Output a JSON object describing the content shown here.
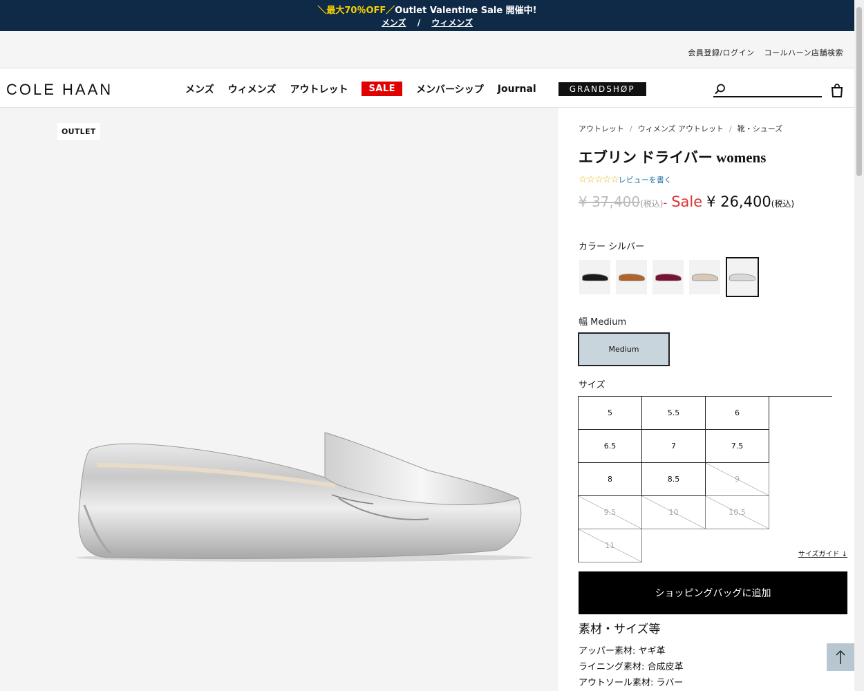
{
  "banner": {
    "promo_highlight": "＼最大70％OFF／",
    "promo_text": "Outlet Valentine Sale 開催中!",
    "link_mens": "メンズ",
    "separator": "/",
    "link_womens": "ウィメンズ"
  },
  "utility": {
    "login": "会員登録/ログイン",
    "store_locator": "コールハーン店舗検索"
  },
  "header": {
    "logo": "COLE HAAN",
    "nav": {
      "mens": "メンズ",
      "womens": "ウィメンズ",
      "outlet": "アウトレット",
      "sale": "SALE",
      "membership": "メンバーシップ",
      "journal": "Journal",
      "grandshop": "GRANDSHØP"
    },
    "search_placeholder": "",
    "search_icon": "search-icon",
    "bag_icon": "shopping-bag-icon"
  },
  "gallery": {
    "badge": "OUTLET"
  },
  "product": {
    "breadcrumb": [
      "アウトレット",
      "ウィメンズ アウトレット",
      "靴・シューズ"
    ],
    "breadcrumb_sep": "/",
    "title": "エブリン ドライバー womens",
    "stars": "☆☆☆☆☆",
    "review_link": "レビューを書く",
    "price": {
      "original": "¥ 37,400",
      "tax_note": "(税込)",
      "dash": "-",
      "sale_label": "Sale",
      "current": "¥ 26,400",
      "tax_note2": "(税込)"
    },
    "color_label": "カラー シルバー",
    "colors": [
      {
        "name": "black",
        "hex": "#1a1a1a"
      },
      {
        "name": "tan",
        "hex": "#b0642a"
      },
      {
        "name": "burgundy",
        "hex": "#7a1236"
      },
      {
        "name": "beige",
        "hex": "#d8c8b8"
      },
      {
        "name": "silver",
        "hex": "#d8d8d8",
        "selected": true
      }
    ],
    "width_label": "幅 Medium",
    "width_option": "Medium",
    "size_label": "サイズ",
    "sizes": [
      {
        "label": "5",
        "available": true
      },
      {
        "label": "5.5",
        "available": true
      },
      {
        "label": "6",
        "available": true
      },
      {
        "label": "6.5",
        "available": true
      },
      {
        "label": "7",
        "available": true
      },
      {
        "label": "7.5",
        "available": true
      },
      {
        "label": "8",
        "available": true
      },
      {
        "label": "8.5",
        "available": true
      },
      {
        "label": "9",
        "available": false
      },
      {
        "label": "9.5",
        "available": false
      },
      {
        "label": "10",
        "available": false
      },
      {
        "label": "10.5",
        "available": false
      },
      {
        "label": "11",
        "available": false
      }
    ],
    "size_guide": "サイズガイド ↓",
    "add_to_bag": "ショッピングバッグに追加",
    "materials_title": "素材・サイズ等",
    "materials": [
      "アッパー素材: ヤギ革",
      "ライニング素材: 合成皮革",
      "アウトソール素材: ラバー"
    ]
  },
  "to_top_icon": "arrow-up-icon"
}
